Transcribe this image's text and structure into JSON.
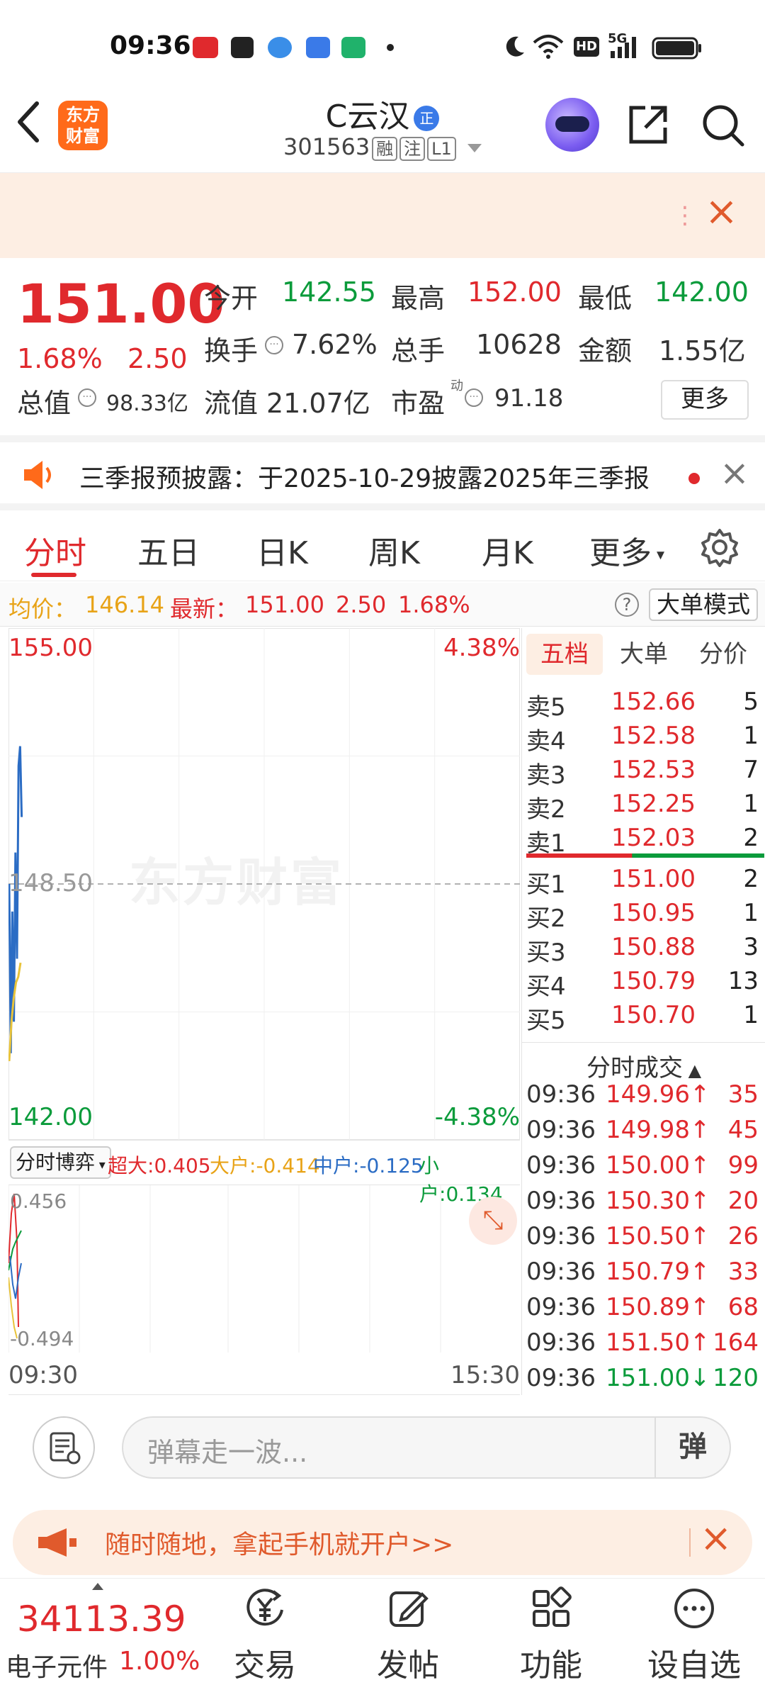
{
  "status_bar": {
    "time": "09:36",
    "hd": "HD",
    "net": "5G"
  },
  "header": {
    "logo": "东方\n财富",
    "stock_name": "C云汉",
    "badge": "正",
    "code": "301563",
    "tags": [
      "融",
      "注",
      "L1"
    ]
  },
  "quote": {
    "price": "151.00",
    "pct": "1.68%",
    "change": "2.50",
    "open_label": "今开",
    "open": "142.55",
    "high_label": "最高",
    "high": "152.00",
    "low_label": "最低",
    "low": "142.00",
    "turnover_label": "换手",
    "turnover": "7.62%",
    "volume_label": "总手",
    "volume": "10628",
    "amount_label": "金额",
    "amount": "1.55亿",
    "mktcap_label": "总值",
    "mktcap": "98.33亿",
    "float_label": "流值",
    "float": "21.07亿",
    "pe_label": "市盈",
    "pe_sup": "动",
    "pe": "91.18",
    "more": "更多"
  },
  "notice": {
    "text": "三季报预披露：于2025-10-29披露2025年三季报"
  },
  "tabs": [
    "分时",
    "五日",
    "日K",
    "周K",
    "月K",
    "更多"
  ],
  "info": {
    "avg_label": "均价：",
    "avg": "146.14",
    "latest_label": "最新：",
    "latest": "151.00",
    "change": "2.50",
    "pct": "1.68%",
    "big_order_mode": "大单模式",
    "help": "?"
  },
  "chart": {
    "top_price": "155.00",
    "top_pct": "4.38%",
    "mid_price": "148.50",
    "bottom_price": "142.00",
    "bottom_pct": "-4.38%",
    "watermark": "东方财富",
    "start_time": "09:30",
    "end_time": "15:30"
  },
  "chart_data": {
    "type": "line",
    "ylim": [
      142.0,
      155.0
    ],
    "reference": 148.5,
    "series": [
      {
        "values": [
          148.5,
          144.2,
          147.8,
          145.0,
          149.3,
          146.6,
          151.5,
          152.0,
          150.2
        ]
      },
      {
        "values": [
          144.0,
          145.0,
          145.6,
          146.0,
          146.14,
          146.5
        ]
      }
    ]
  },
  "flow": {
    "selector": "分时博弈",
    "super_label": "超大:",
    "super": "0.405",
    "large_label": "大户:",
    "large": "-0.414",
    "mid_label": "中户:",
    "mid": "-0.125",
    "small_label": "小户:",
    "small": "0.134",
    "top": "0.456",
    "bottom": "-0.494"
  },
  "order_book": {
    "tabs": [
      "五档",
      "大单",
      "分价"
    ],
    "asks": [
      {
        "label": "卖5",
        "price": "152.66",
        "vol": "5"
      },
      {
        "label": "卖4",
        "price": "152.58",
        "vol": "1"
      },
      {
        "label": "卖3",
        "price": "152.53",
        "vol": "7"
      },
      {
        "label": "卖2",
        "price": "152.25",
        "vol": "1"
      },
      {
        "label": "卖1",
        "price": "152.03",
        "vol": "2"
      }
    ],
    "bids": [
      {
        "label": "买1",
        "price": "151.00",
        "vol": "2"
      },
      {
        "label": "买2",
        "price": "150.95",
        "vol": "1"
      },
      {
        "label": "买3",
        "price": "150.88",
        "vol": "3"
      },
      {
        "label": "买4",
        "price": "150.79",
        "vol": "13"
      },
      {
        "label": "买5",
        "price": "150.70",
        "vol": "1"
      }
    ],
    "deals_title": "分时成交",
    "deals": [
      {
        "time": "09:36",
        "price": "149.96",
        "dir": "↑",
        "vol": "35"
      },
      {
        "time": "09:36",
        "price": "149.98",
        "dir": "↑",
        "vol": "45"
      },
      {
        "time": "09:36",
        "price": "150.00",
        "dir": "↑",
        "vol": "99"
      },
      {
        "time": "09:36",
        "price": "150.30",
        "dir": "↑",
        "vol": "20"
      },
      {
        "time": "09:36",
        "price": "150.50",
        "dir": "↑",
        "vol": "26"
      },
      {
        "time": "09:36",
        "price": "150.79",
        "dir": "↑",
        "vol": "33"
      },
      {
        "time": "09:36",
        "price": "150.89",
        "dir": "↑",
        "vol": "68"
      },
      {
        "time": "09:36",
        "price": "151.50",
        "dir": "↑",
        "vol": "164"
      },
      {
        "time": "09:36",
        "price": "151.00",
        "dir": "↓",
        "vol": "120"
      }
    ]
  },
  "comment": {
    "placeholder": "弹幕走一波...",
    "danmu": "弹"
  },
  "promo": {
    "text": "随时随地，拿起手机就开户>>"
  },
  "bottom_nav": {
    "index_value": "34113.39",
    "index_name": "电子元件",
    "index_pct": "1.00%",
    "items": [
      "交易",
      "发帖",
      "功能",
      "设自选"
    ]
  },
  "colors": {
    "up": "#e0292d",
    "down": "#0b9b3b",
    "accent": "#ff6a1a",
    "price_line": "#2b6cc4",
    "avg_line": "#e8c33a"
  }
}
